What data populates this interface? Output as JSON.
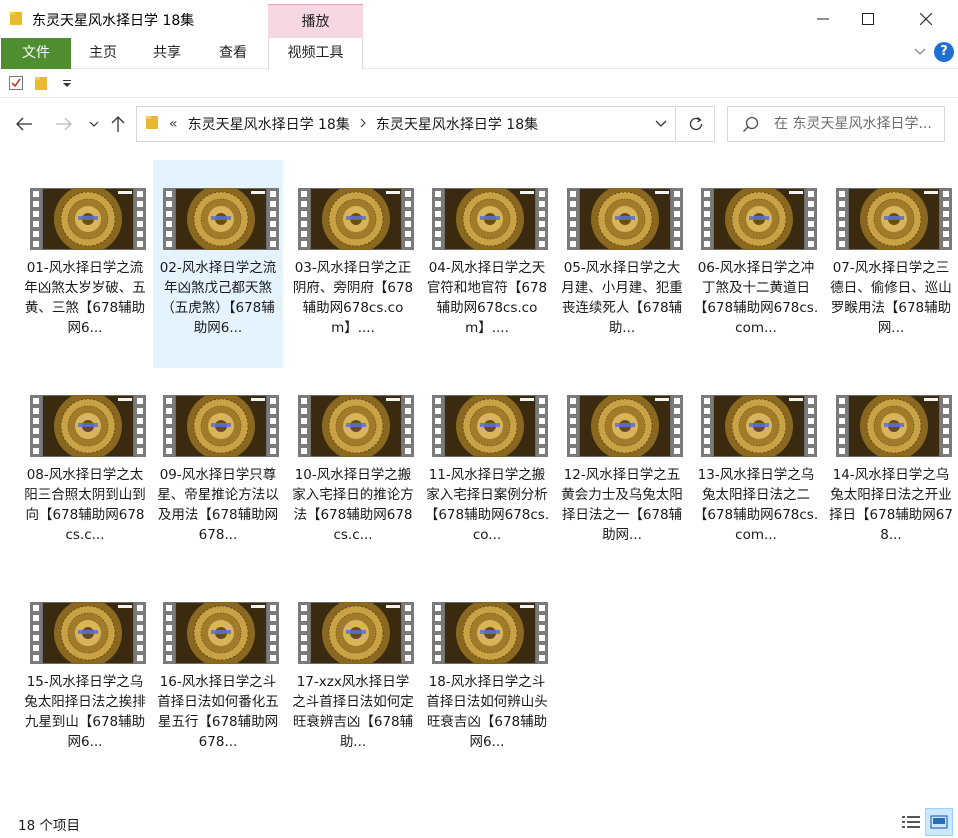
{
  "window": {
    "title": "东灵天星风水择日学 18集",
    "context_tab_header": "播放"
  },
  "ribbon": {
    "tabs": [
      {
        "label": "文件"
      },
      {
        "label": "主页"
      },
      {
        "label": "共享"
      },
      {
        "label": "查看"
      },
      {
        "label": "视频工具"
      }
    ]
  },
  "address": {
    "overflow": "«",
    "crumbs": [
      "东灵天星风水择日学 18集",
      "东灵天星风水择日学 18集"
    ]
  },
  "search": {
    "placeholder": "在 东灵天星风水择日学..."
  },
  "files": [
    {
      "label": "01-风水择日学之流年凶煞太岁岁破、五黄、三煞【678辅助网6..."
    },
    {
      "label": "02-风水择日学之流年凶煞戊己都天煞（五虎煞）【678辅助网6..."
    },
    {
      "label": "03-风水择日学之正阴府、旁阴府【678辅助网678cs.com】...."
    },
    {
      "label": "04-风水择日学之天官符和地官符【678辅助网678cs.com】...."
    },
    {
      "label": "05-风水择日学之大月建、小月建、犯重丧连续死人【678辅助..."
    },
    {
      "label": "06-风水择日学之冲丁煞及十二黄道日【678辅助网678cs.com..."
    },
    {
      "label": "07-风水择日学之三德日、偷修日、巡山罗睺用法【678辅助网..."
    },
    {
      "label": "08-风水择日学之太阳三合照太阴到山到向【678辅助网678cs.c..."
    },
    {
      "label": "09-风水择日学只尊星、帝星推论方法以及用法【678辅助网678..."
    },
    {
      "label": "10-风水择日学之搬家入宅择日的推论方法【678辅助网678cs.c..."
    },
    {
      "label": "11-风水择日学之搬家入宅择日案例分析【678辅助网678cs.co..."
    },
    {
      "label": "12-风水择日学之五黄会力士及乌兔太阳择日法之一【678辅助网..."
    },
    {
      "label": "13-风水择日学之乌兔太阳择日法之二【678辅助网678cs.com..."
    },
    {
      "label": "14-风水择日学之乌兔太阳择日法之开业择日【678辅助网678..."
    },
    {
      "label": "15-风水择日学之乌兔太阳择日法之挨排九星到山【678辅助网6..."
    },
    {
      "label": "16-风水择日学之斗首择日法如何番化五星五行【678辅助网678..."
    },
    {
      "label": "17-xzx风水择日学之斗首择日法如何定旺衰辨吉凶【678辅助..."
    },
    {
      "label": "18-风水择日学之斗首择日法如何辨山头旺衰吉凶【678辅助网6..."
    }
  ],
  "selected_index": 1,
  "status": {
    "count": "18 个项目"
  },
  "colors": {
    "file_tab": "#4e8e2f",
    "context_tab": "#f8d7e4",
    "selection": "#e5f3ff",
    "help": "#1e6fd1"
  }
}
